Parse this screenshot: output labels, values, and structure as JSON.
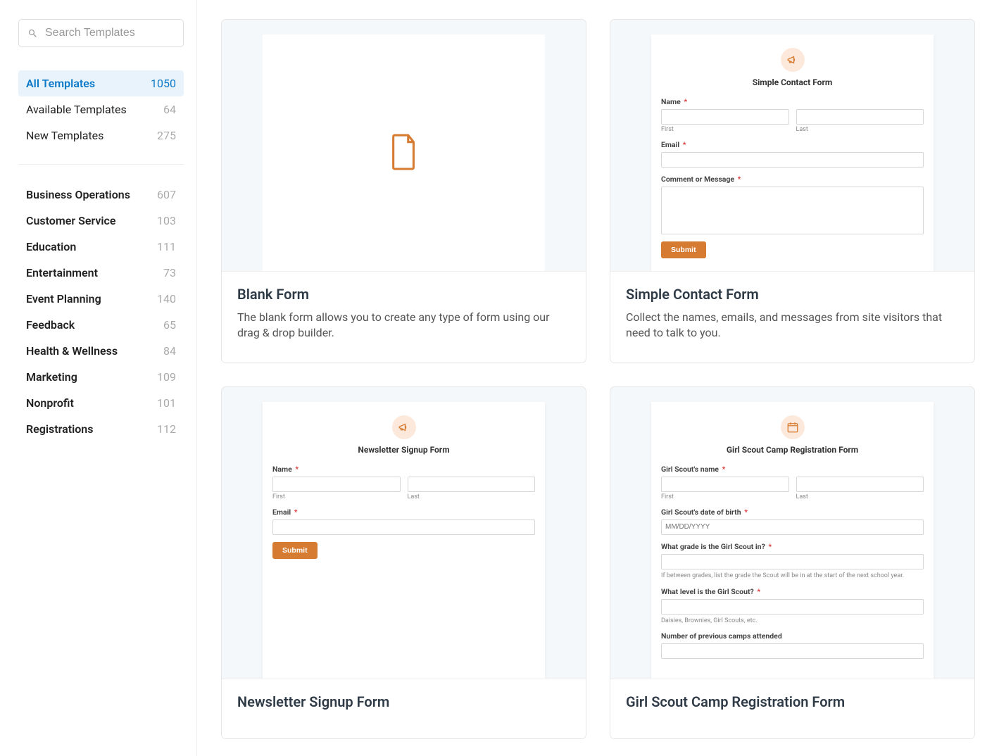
{
  "search": {
    "placeholder": "Search Templates"
  },
  "filters": [
    {
      "label": "All Templates",
      "count": "1050",
      "active": true
    },
    {
      "label": "Available Templates",
      "count": "64",
      "active": false
    },
    {
      "label": "New Templates",
      "count": "275",
      "active": false
    }
  ],
  "categories": [
    {
      "label": "Business Operations",
      "count": "607"
    },
    {
      "label": "Customer Service",
      "count": "103"
    },
    {
      "label": "Education",
      "count": "111"
    },
    {
      "label": "Entertainment",
      "count": "73"
    },
    {
      "label": "Event Planning",
      "count": "140"
    },
    {
      "label": "Feedback",
      "count": "65"
    },
    {
      "label": "Health & Wellness",
      "count": "84"
    },
    {
      "label": "Marketing",
      "count": "109"
    },
    {
      "label": "Nonprofit",
      "count": "101"
    },
    {
      "label": "Registrations",
      "count": "112"
    }
  ],
  "cards": [
    {
      "title": "Blank Form",
      "desc": "The blank form allows you to create any type of form using our drag & drop builder."
    },
    {
      "title": "Simple Contact Form",
      "desc": "Collect the names, emails, and messages from site visitors that need to talk to you.",
      "form": {
        "title": "Simple Contact Form",
        "name_label": "Name",
        "first": "First",
        "last": "Last",
        "email_label": "Email",
        "comment_label": "Comment or Message",
        "submit": "Submit"
      }
    },
    {
      "title": "Newsletter Signup Form",
      "form": {
        "title": "Newsletter Signup Form",
        "name_label": "Name",
        "first": "First",
        "last": "Last",
        "email_label": "Email",
        "submit": "Submit"
      }
    },
    {
      "title": "Girl Scout Camp Registration Form",
      "form": {
        "title": "Girl Scout Camp Registration Form",
        "name_label": "Girl Scout's name",
        "first": "First",
        "last": "Last",
        "dob_label": "Girl Scout's date of birth",
        "dob_placeholder": "MM/DD/YYYY",
        "grade_label": "What grade is the Girl Scout in?",
        "grade_hint": "If between grades, list the grade the Scout will be in at the start of the next school year.",
        "level_label": "What level is the Girl Scout?",
        "level_hint": "Daisies, Brownies, Girl Scouts, etc.",
        "camps_label": "Number of previous camps attended"
      }
    }
  ]
}
